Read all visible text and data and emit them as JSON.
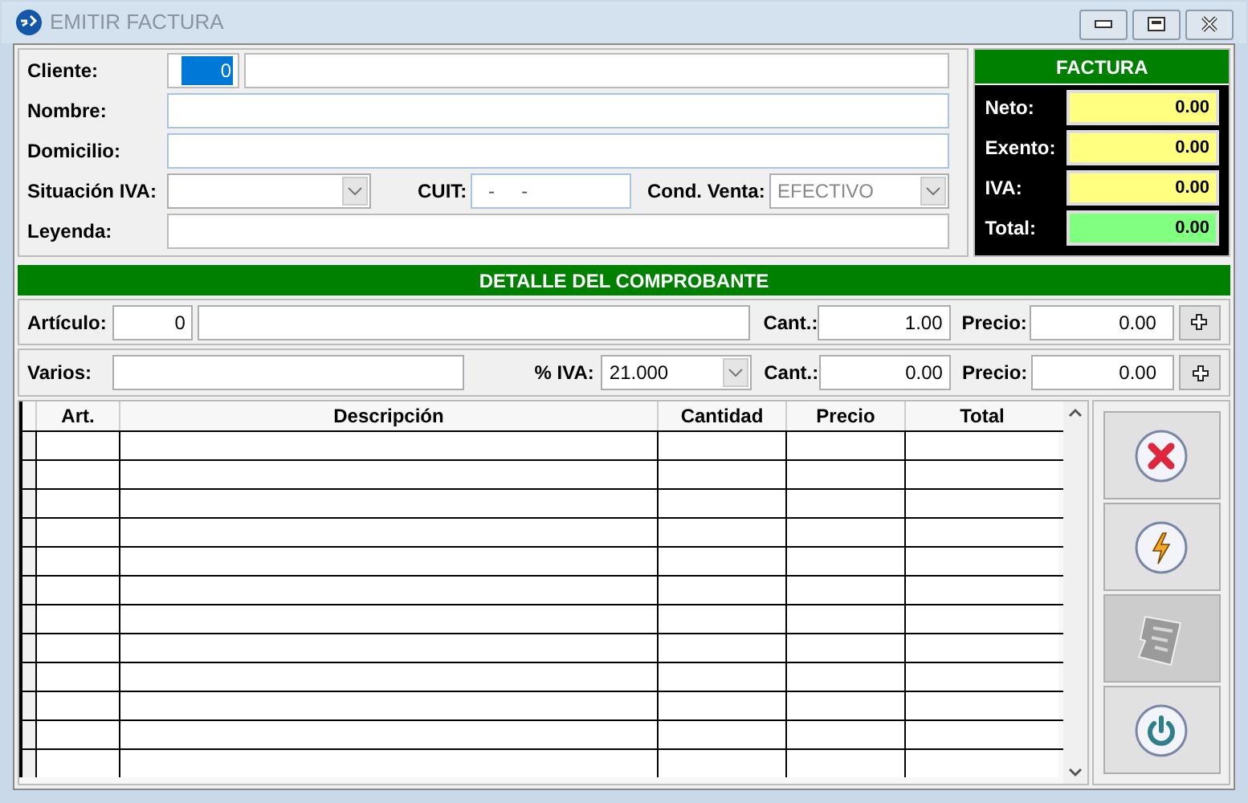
{
  "window": {
    "title": "EMITIR FACTURA"
  },
  "client": {
    "cliente": {
      "label": "Cliente:",
      "code": "0",
      "code_selected": true
    },
    "nombre": {
      "label": "Nombre:"
    },
    "domicilio": {
      "label": "Domicilio:"
    },
    "situacion_iva": {
      "label": "Situación IVA:"
    },
    "cuit": {
      "label": "CUIT:",
      "value": "-     -"
    },
    "cond_venta": {
      "label": "Cond. Venta:",
      "value": "EFECTIVO",
      "disabled": true
    },
    "leyenda": {
      "label": "Leyenda:"
    }
  },
  "factura": {
    "title": "FACTURA",
    "totals": [
      {
        "label": "Neto:",
        "value": "0.00",
        "kind": "subtotal"
      },
      {
        "label": "Exento:",
        "value": "0.00",
        "kind": "subtotal"
      },
      {
        "label": "IVA:",
        "value": "0.00",
        "kind": "subtotal"
      },
      {
        "label": "Total:",
        "value": "0.00",
        "kind": "total"
      }
    ]
  },
  "detalle": {
    "title": "DETALLE DEL COMPROBANTE",
    "articulo": {
      "label": "Artículo:",
      "code": "0",
      "cant_label": "Cant.:",
      "cant": "1.00",
      "precio_label": "Precio:",
      "precio": "0.00"
    },
    "varios": {
      "label": "Varios:",
      "iva_label": "% IVA:",
      "iva": "21.000",
      "cant_label": "Cant.:",
      "cant": "0.00",
      "precio_label": "Precio:",
      "precio": "0.00"
    }
  },
  "table": {
    "columns": [
      "Art.",
      "Descripción",
      "Cantidad",
      "Precio",
      "Total"
    ]
  },
  "actions": [
    {
      "kind": "cancel",
      "disabled": false
    },
    {
      "kind": "process",
      "disabled": false
    },
    {
      "kind": "print",
      "disabled": true
    },
    {
      "kind": "exit",
      "disabled": false
    }
  ]
}
